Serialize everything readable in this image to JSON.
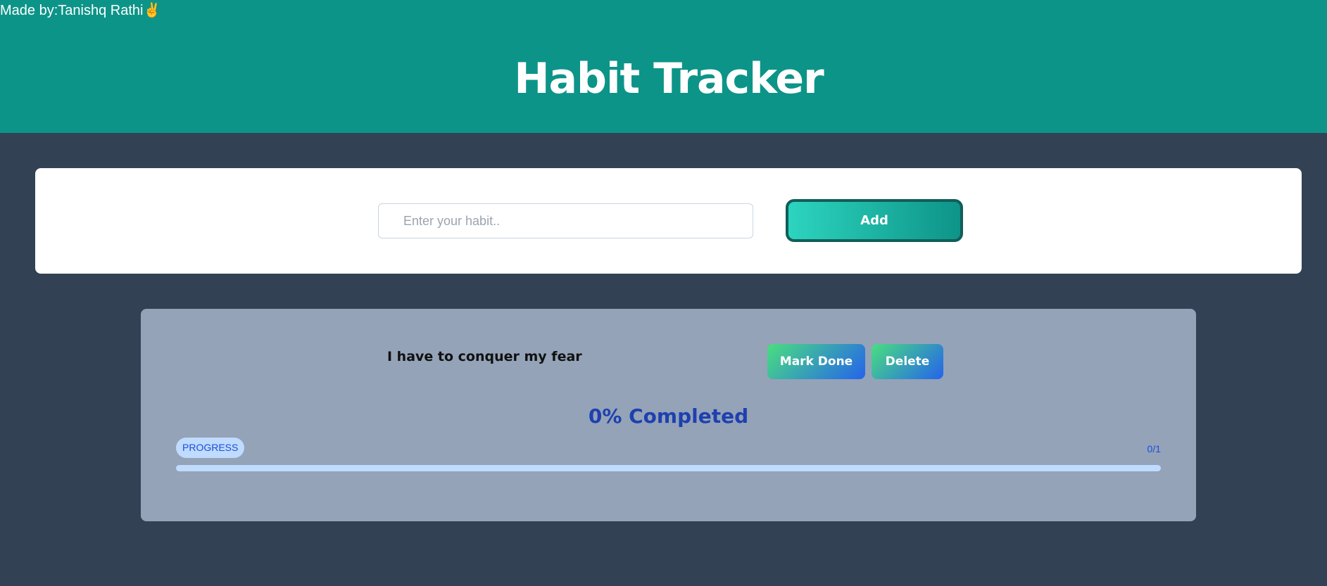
{
  "header": {
    "credit": "Made by:Tanishq Rathi",
    "credit_emoji": "✌",
    "title": "Habit Tracker",
    "background_color": "#0d9488"
  },
  "add_form": {
    "input_placeholder": "Enter your habit..",
    "input_value": "",
    "add_label": "Add"
  },
  "habits": [
    {
      "name": "I have to conquer my fear",
      "mark_done_label": "Mark Done",
      "delete_label": "Delete",
      "completed_text": "0% Completed",
      "progress_label": "PROGRESS",
      "progress_count": "0/1",
      "progress_fraction": 0
    }
  ],
  "colors": {
    "page_background": "#334155",
    "card_background": "#94a3b8",
    "accent_blue": "#1e40af"
  }
}
